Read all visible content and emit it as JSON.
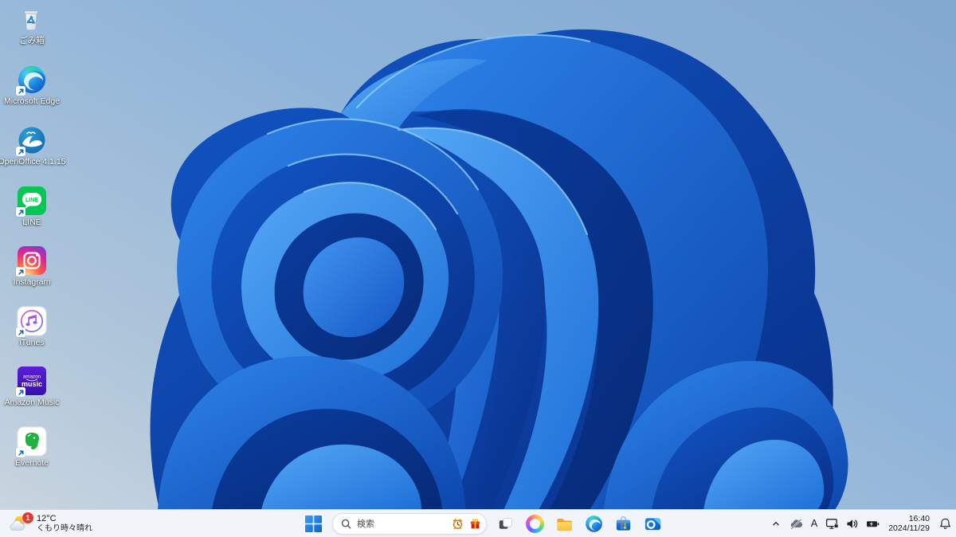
{
  "wallpaper": {
    "name": "windows-11-bloom"
  },
  "desktop": {
    "icons": [
      {
        "label": "ごみ箱",
        "name": "recycle-bin",
        "shortcut": false
      },
      {
        "label": "Microsoft Edge",
        "name": "microsoft-edge",
        "shortcut": true
      },
      {
        "label": "OpenOffice 4.1.15",
        "name": "openoffice",
        "shortcut": true
      },
      {
        "label": "LINE",
        "name": "line",
        "shortcut": true
      },
      {
        "label": "Instagram",
        "name": "instagram",
        "shortcut": true
      },
      {
        "label": "iTunes",
        "name": "itunes",
        "shortcut": true
      },
      {
        "label": "Amazon Music",
        "name": "amazon-music",
        "shortcut": true
      },
      {
        "label": "Evernote",
        "name": "evernote",
        "shortcut": true
      }
    ],
    "icon_art_text": {
      "line_bubble": "LINE",
      "amazon_line1": "amazon",
      "amazon_line2": "music"
    }
  },
  "taskbar": {
    "weather": {
      "badge": "1",
      "temperature": "12°C",
      "condition": "くもり時々晴れ"
    },
    "search": {
      "placeholder": "検索"
    },
    "pinned_icons": [
      "start",
      "task-view",
      "copilot",
      "file-explorer",
      "edge",
      "microsoft-store",
      "outlook"
    ],
    "tray": {
      "ime_mode": "A",
      "time": "16:40",
      "date": "2024/11/29"
    }
  },
  "colors": {
    "desktop_top": "#8fb4d9",
    "desktop_bottom_left": "#ccd7e0",
    "taskbar_bg": "#f1f5fa",
    "badge_red": "#e53935",
    "bloom_bright": "#55a8f6",
    "bloom_mid": "#2f86ec",
    "bloom_dark": "#0b3da5",
    "line_green": "#06c755",
    "evernote_green": "#1fb141",
    "amazon_violet": "#4a16c8"
  }
}
